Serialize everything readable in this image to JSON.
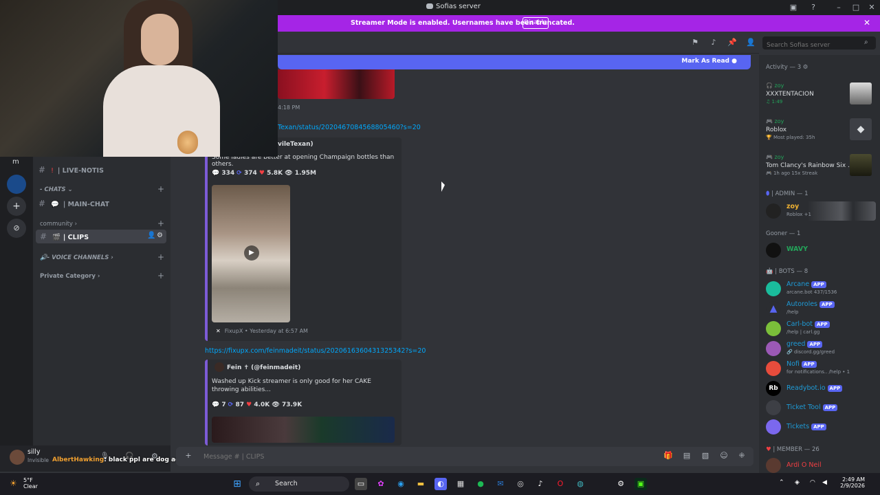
{
  "window": {
    "title": "Sofias server",
    "controls": [
      "minimize",
      "maximize",
      "close"
    ]
  },
  "banner": {
    "message": "Streamer Mode is enabled. Usernames have been truncated.",
    "disable_label": "Disable"
  },
  "header": {
    "search_placeholder": "Search Sofias server"
  },
  "mark_as_read": "Mark As Read",
  "sidebar": {
    "server_letter": "m",
    "channels": [
      {
        "icon": "!",
        "label": "| LIVE-NOTIS"
      },
      {
        "label": "- CHATS"
      },
      {
        "label": "| MAIN-CHAT"
      },
      {
        "label": "community"
      },
      {
        "label": "| CLIPS"
      },
      {
        "label": "- VOICE CHANNELS"
      },
      {
        "label": "Private Category"
      }
    ]
  },
  "user_panel": {
    "name": "silly",
    "status": "Invisible"
  },
  "overlay_chat": {
    "user": "AlbertHawking",
    "message": "black ppl are dog adjacent on"
  },
  "messages": {
    "first_time": "4:18 PM",
    "first_link": "Texan/status/2020467084568805460?s=20",
    "first_author": "vileTexan)",
    "first_text": "Some ladies are better at opening Champaign bottles than others.",
    "first_stats": {
      "replies": "334",
      "retweets": "374",
      "likes": "5.8K",
      "views": "1.95M"
    },
    "first_footer": "FixupX • Yesterday at 6:57 AM",
    "second_link": "https://fixupx.com/feinmadeit/status/2020616360431325342?s=20",
    "second_author": "Fein ✝ (@feinmadeit)",
    "second_text": "Washed up Kick streamer is only good for her CAKE throwing abilities...",
    "second_stats": {
      "replies": "7",
      "retweets": "87",
      "likes": "4.0K",
      "views": "73.9K"
    }
  },
  "composer": {
    "placeholder": "Message # | CLIPS"
  },
  "members": {
    "activity_header": "Activity — 3",
    "activity": [
      {
        "name": "zoy",
        "title": "XXXTENTACION",
        "sub": "1:49"
      },
      {
        "name": "zoy",
        "title": "Roblox",
        "sub": "Most played: 35h"
      },
      {
        "name": "zoy",
        "title": "Tom Clancy's Rainbow Six ...",
        "sub": "1h ago  15x Streak"
      }
    ],
    "admin_header": "| ADMIN — 1",
    "admin": {
      "name": "zoy",
      "sub": "Roblox +1"
    },
    "gooner_header": "Gooner — 1",
    "gooner": {
      "name": "WAVY"
    },
    "bots_header": "| BOTS — 8",
    "bots": [
      {
        "name": "Arcane",
        "sub": "arcane.bot 437/1536",
        "color": "#1abc9c"
      },
      {
        "name": "Autoroles",
        "sub": "/help",
        "color": "#5865f2"
      },
      {
        "name": "Carl-bot",
        "sub": "/help | carl.gg",
        "color": "#2ecc71"
      },
      {
        "name": "greed",
        "sub": "discord.gg/greed",
        "color": "#9b59b6"
      },
      {
        "name": "Nofi",
        "sub": "for notifications.. /help • 1",
        "color": "#e74c3c"
      },
      {
        "name": "Readybot.io",
        "sub": "",
        "color": "#000000"
      },
      {
        "name": "Ticket Tool",
        "sub": "",
        "color": "#3d3f45"
      },
      {
        "name": "Tickets",
        "sub": "",
        "color": "#7b68ee"
      }
    ],
    "app_tag": "APP",
    "member_header": "| MEMBER — 26",
    "member_first": "Ardi O Neil"
  },
  "taskbar": {
    "temp": "5°F",
    "weather": "Clear",
    "search_label": "Search",
    "time": "2:49 AM",
    "date": "2/9/2026"
  }
}
